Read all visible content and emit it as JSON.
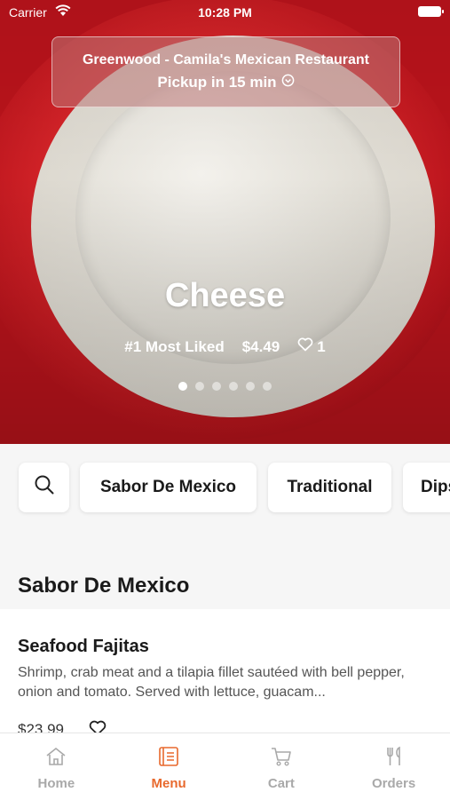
{
  "status_bar": {
    "carrier": "Carrier",
    "time": "10:28 PM"
  },
  "banner": {
    "restaurant": "Greenwood - Camila's Mexican Restaurant",
    "pickup": "Pickup in 15 min"
  },
  "featured": {
    "name": "Cheese",
    "rank": "#1 Most Liked",
    "price": "$4.49",
    "likes": "1",
    "carousel_count": 6,
    "carousel_active": 1
  },
  "categories": [
    "Sabor De Mexico",
    "Traditional",
    "Dips"
  ],
  "section_title": "Sabor De Mexico",
  "menu_item": {
    "name": "Seafood Fajitas",
    "description": "Shrimp, crab meat and a tilapia fillet sautéed with bell pepper, onion and tomato. Served with lettuce, guacam...",
    "price": "$23.99"
  },
  "tabs": [
    {
      "label": "Home",
      "icon": "home-icon"
    },
    {
      "label": "Menu",
      "icon": "menu-book-icon"
    },
    {
      "label": "Cart",
      "icon": "cart-icon"
    },
    {
      "label": "Orders",
      "icon": "fork-knife-icon"
    }
  ],
  "active_tab": "Menu",
  "colors": {
    "accent": "#e8692d",
    "tab_inactive": "#a9a9a9"
  }
}
